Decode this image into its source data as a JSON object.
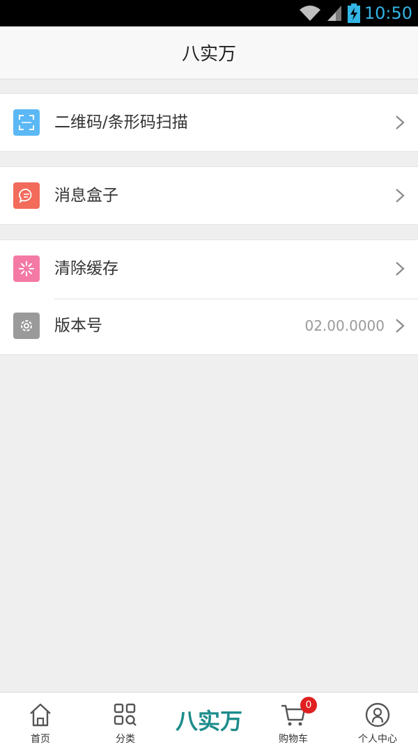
{
  "status_bar": {
    "time": "10:50",
    "icons": [
      "wifi-icon",
      "signal-icon",
      "battery-charging-icon"
    ]
  },
  "header": {
    "title": "八实万"
  },
  "menu": {
    "groups": [
      {
        "items": [
          {
            "label": "二维码/条形码扫描",
            "icon": "scan-icon",
            "icon_color": "#5bb8f5"
          }
        ]
      },
      {
        "items": [
          {
            "label": "消息盒子",
            "icon": "message-icon",
            "icon_color": "#f26b5b"
          }
        ]
      },
      {
        "items": [
          {
            "label": "清除缓存",
            "icon": "clear-cache-icon",
            "icon_color": "#f47aa5"
          },
          {
            "label": "版本号",
            "value": "02.00.0000",
            "icon": "settings-gear-icon",
            "icon_color": "#9a9a9a"
          }
        ]
      }
    ]
  },
  "bottom_nav": {
    "items": [
      {
        "label": "首页",
        "icon": "home-icon"
      },
      {
        "label": "分类",
        "icon": "category-search-icon"
      },
      {
        "brand": "八实万"
      },
      {
        "label": "购物车",
        "icon": "cart-icon",
        "badge": "0"
      },
      {
        "label": "个人中心",
        "icon": "user-icon"
      }
    ]
  }
}
